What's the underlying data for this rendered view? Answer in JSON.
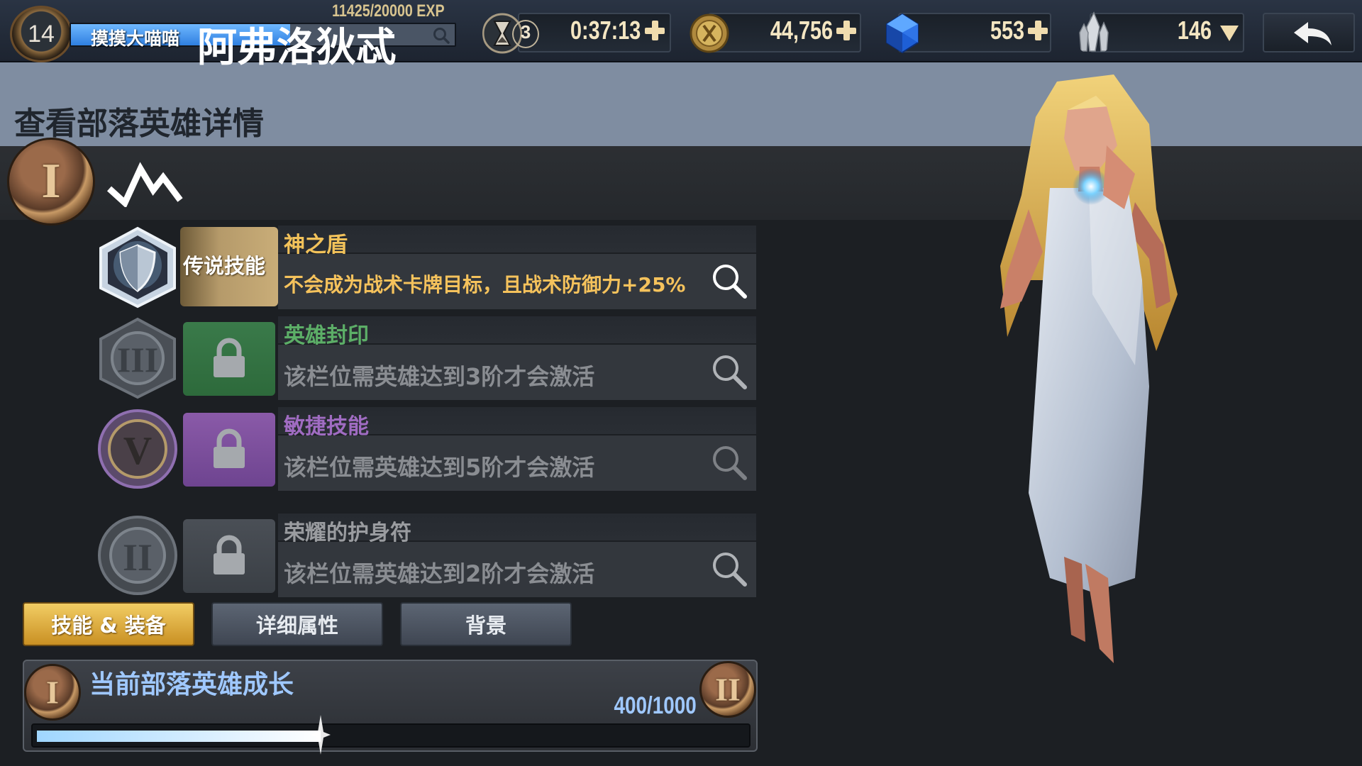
{
  "player": {
    "level": "14",
    "name": "摸摸大喵喵",
    "exp_text": "11425/20000 EXP",
    "exp_progress": 0.5713
  },
  "resources": {
    "timer": {
      "count": "3",
      "value": "0:37:13",
      "icon": "hourglass-icon"
    },
    "gold": {
      "value": "44,756",
      "icon": "coin-icon"
    },
    "gems": {
      "value": "553",
      "icon": "blue-gem-icon"
    },
    "crystals": {
      "value": "146",
      "icon": "crystal-icon"
    }
  },
  "page": {
    "title": "查看部落英雄详情"
  },
  "hero": {
    "tier": "I",
    "name": "阿弗洛狄忒"
  },
  "skills": [
    {
      "slot": "legendary",
      "badge": "传说技能",
      "title": "神之盾",
      "desc": "不会成为战术卡牌目标，且战术防御力+25%",
      "locked": false,
      "title_color": "#f2c25a",
      "desc_color": "#f5c25c"
    },
    {
      "slot": "seal",
      "tier": "III",
      "title": "英雄封印",
      "desc": "该栏位需英雄达到3阶才会激活",
      "locked": true,
      "title_color": "#5cae67"
    },
    {
      "slot": "agility",
      "tier": "V",
      "title": "敏捷技能",
      "desc": "该栏位需英雄达到5阶才会激活",
      "locked": true,
      "title_color": "#a06cc2"
    },
    {
      "slot": "amulet",
      "tier": "II",
      "title": "荣耀的护身符",
      "desc": "该栏位需英雄达到2阶才会激活",
      "locked": true,
      "title_color": "#9a9ca0"
    }
  ],
  "tabs": [
    {
      "label": "技能 & 装备",
      "active": true
    },
    {
      "label": "详细属性",
      "active": false
    },
    {
      "label": "背景",
      "active": false
    }
  ],
  "growth": {
    "title": "当前部落英雄成长",
    "value_text": "400/1000",
    "progress": 0.4,
    "from_tier": "I",
    "to_tier": "II"
  }
}
